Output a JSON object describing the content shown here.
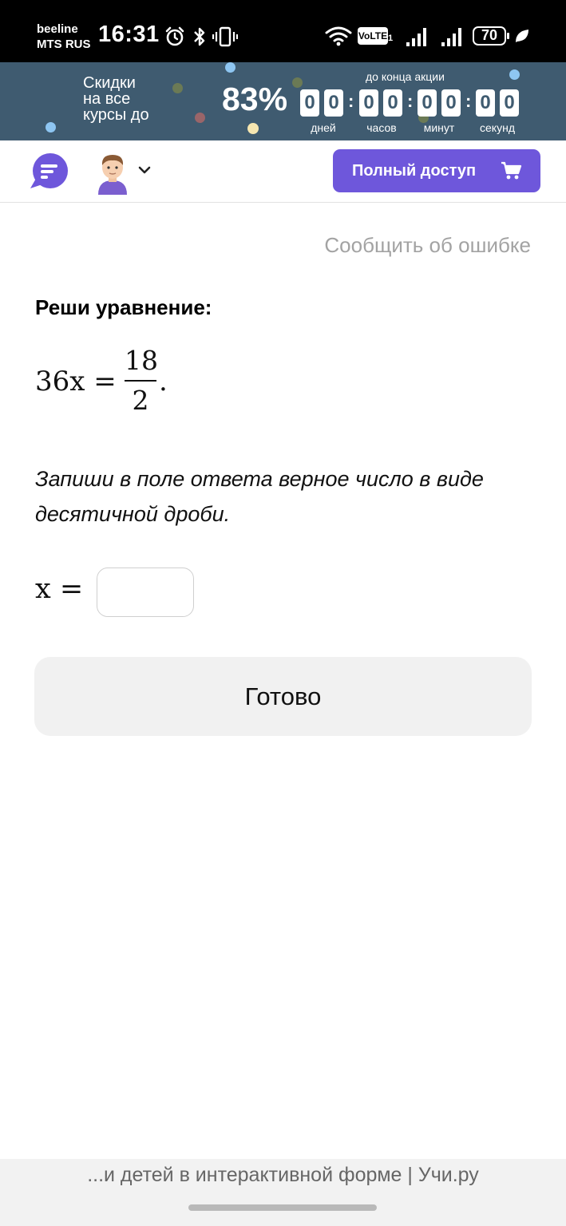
{
  "status_bar": {
    "carrier_1": "beeline",
    "carrier_2": "MTS RUS",
    "time": "16:31",
    "volte_label": "VoLTE",
    "volte_sub": "1",
    "battery": "70",
    "icons": [
      "alarm-icon",
      "bluetooth-icon",
      "vibrate-icon",
      "wifi-icon",
      "volte-icon",
      "signal-icon",
      "signal-icon",
      "battery-icon",
      "leaf-icon"
    ]
  },
  "promo": {
    "line_1": "Скидки",
    "line_2": "на все",
    "line_3": "курсы до",
    "discount": "83%",
    "until_label": "до конца акции",
    "days": [
      "0",
      "0"
    ],
    "hours": [
      "0",
      "0"
    ],
    "minutes": [
      "0",
      "0"
    ],
    "seconds": [
      "0",
      "0"
    ],
    "colon": ":",
    "labels": {
      "days": "дней",
      "hours": "часов",
      "minutes": "минут",
      "seconds": "секунд"
    },
    "background_color": "#3f5b70"
  },
  "nav": {
    "chat_icon": "chat-icon",
    "avatar": "avatar",
    "full_access_label": "Полный доступ",
    "cart_icon": "cart-icon",
    "accent_color": "#6e57db"
  },
  "task": {
    "report_error": "Сообщить об ошибке",
    "title": "Реши уравнение:",
    "equation": {
      "lhs": "36x =",
      "numerator": "18",
      "denominator": "2",
      "end": "."
    },
    "instruction": "Запиши в поле ответа верное число в виде десятичной дроби.",
    "answer_label": "x =",
    "answer_value": "",
    "done_label": "Готово"
  },
  "browser": {
    "page_title": "...и детей в интерактивной форме | Учи.ру"
  }
}
